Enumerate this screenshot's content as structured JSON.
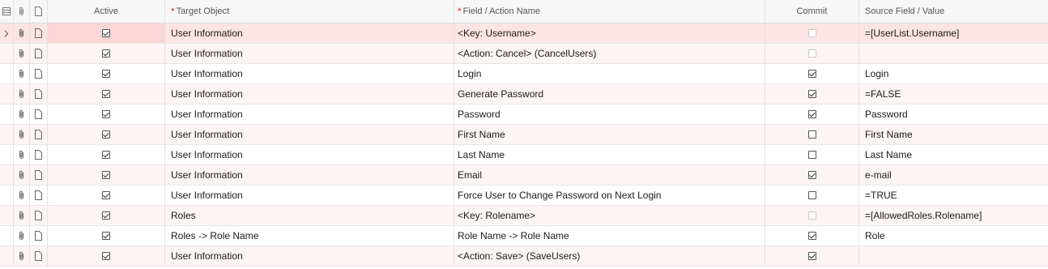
{
  "columns": {
    "active": "Active",
    "target_object": "Target Object",
    "field_action_name": "Field / Action Name",
    "commit": "Commit",
    "source_field_value": "Source Field / Value",
    "required_marker": "*"
  },
  "rows": [
    {
      "active": true,
      "target": "User Information",
      "field": "<Key: Username>",
      "commit": false,
      "commit_disabled": true,
      "source": "=[UserList.Username]",
      "selected": true
    },
    {
      "active": true,
      "target": "User Information",
      "field": "<Action: Cancel> (CancelUsers)",
      "commit": false,
      "commit_disabled": true,
      "source": ""
    },
    {
      "active": true,
      "target": "User Information",
      "field": "Login",
      "commit": true,
      "commit_disabled": false,
      "source": "Login"
    },
    {
      "active": true,
      "target": "User Information",
      "field": "Generate Password",
      "commit": true,
      "commit_disabled": false,
      "source": "=FALSE"
    },
    {
      "active": true,
      "target": "User Information",
      "field": "Password",
      "commit": true,
      "commit_disabled": false,
      "source": "Password"
    },
    {
      "active": true,
      "target": "User Information",
      "field": "First Name",
      "commit": false,
      "commit_disabled": false,
      "source": "First Name"
    },
    {
      "active": true,
      "target": "User Information",
      "field": "Last Name",
      "commit": false,
      "commit_disabled": false,
      "source": "Last Name"
    },
    {
      "active": true,
      "target": "User Information",
      "field": "Email",
      "commit": true,
      "commit_disabled": false,
      "source": "e-mail"
    },
    {
      "active": true,
      "target": "User Information",
      "field": "Force User to Change Password on Next Login",
      "commit": false,
      "commit_disabled": false,
      "source": "=TRUE"
    },
    {
      "active": true,
      "target": "Roles",
      "field": "<Key: Rolename>",
      "commit": false,
      "commit_disabled": true,
      "source": "=[AllowedRoles.Rolename]"
    },
    {
      "active": true,
      "target": "Roles -> Role Name",
      "field": "Role Name -> Role Name",
      "commit": true,
      "commit_disabled": false,
      "source": "Role"
    },
    {
      "active": true,
      "target": "User Information",
      "field": "<Action: Save> (SaveUsers)",
      "commit": true,
      "commit_disabled": false,
      "source": ""
    }
  ],
  "icons": {
    "header_row_selector": "row-selector-icon",
    "attachment": "paperclip-icon",
    "note": "note-icon",
    "current_row": "chevron-right-icon"
  },
  "colors": {
    "selected_row": "#fde4e4",
    "alt_row": "#fdf4f4",
    "required": "#dd2222"
  }
}
